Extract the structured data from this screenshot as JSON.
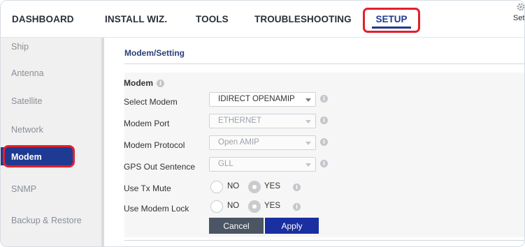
{
  "nav": {
    "items": [
      "DASHBOARD",
      "INSTALL WIZ.",
      "TOOLS",
      "TROUBLESHOOTING"
    ],
    "active": "SETUP",
    "settings_label": "Set"
  },
  "sidebar": {
    "items": [
      "Ship",
      "Antenna",
      "Satellite",
      "Network",
      "Modem",
      "SNMP",
      "Backup & Restore"
    ],
    "active_index": 4
  },
  "main": {
    "section_title": "Modem/Setting",
    "panel_heading": "Modem",
    "fields": {
      "select_modem": {
        "label": "Select Modem",
        "value": "IDIRECT OPENAMIP"
      },
      "modem_port": {
        "label": "Modem Port",
        "value": "ETHERNET"
      },
      "modem_protocol": {
        "label": "Modem Protocol",
        "value": "Open AMIP"
      },
      "gps_out": {
        "label": "GPS Out Sentence",
        "value": "GLL"
      },
      "tx_mute": {
        "label": "Use Tx Mute",
        "no": "NO",
        "yes": "YES",
        "selected": "YES"
      },
      "modem_lock": {
        "label": "Use Modem Lock",
        "no": "NO",
        "yes": "YES",
        "selected": "YES"
      }
    },
    "buttons": {
      "cancel": "Cancel",
      "apply": "Apply"
    }
  },
  "colors": {
    "accent": "#1f3a93",
    "highlight": "#e2202a",
    "apply": "#1a2fa0",
    "cancel": "#4b5563"
  },
  "icons": {
    "settings": "gear-icon",
    "info": "info-icon"
  }
}
